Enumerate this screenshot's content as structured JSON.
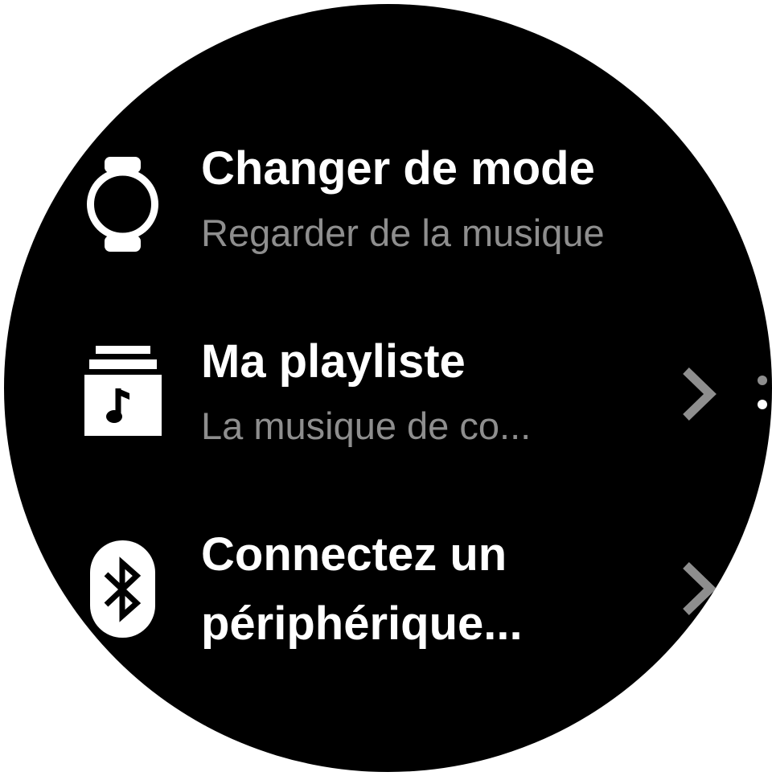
{
  "colors": {
    "background": "#000000",
    "title": "#ffffff",
    "subtitle": "#8e8e8e",
    "chevron": "#8e8e8e"
  },
  "menu": {
    "items": [
      {
        "icon": "watch-icon",
        "title": "Changer de mode",
        "subtitle": "Regarder de la musique"
      },
      {
        "icon": "playlist-music-icon",
        "title": "Ma playliste",
        "subtitle": "La musique de co...",
        "chevron": "chevron-right-icon"
      },
      {
        "icon": "bluetooth-icon",
        "title_line1": "Connectez un",
        "title_line2": "périphérique...",
        "chevron": "chevron-right-icon"
      }
    ]
  },
  "scroll_indicator": {
    "icon": "scroll-dots-icon"
  }
}
